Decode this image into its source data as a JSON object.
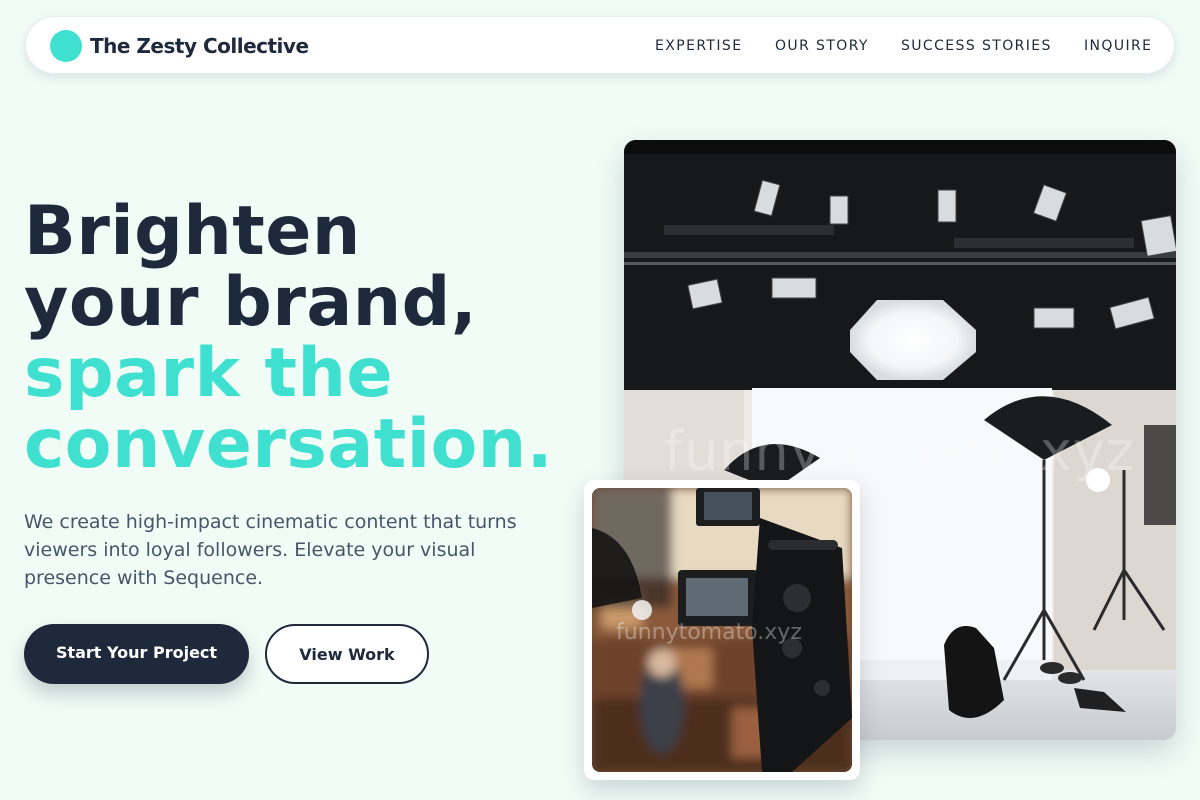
{
  "brand": {
    "name": "The Zesty Collective",
    "accent_color": "#40e0d0",
    "dark_color": "#1e293b"
  },
  "nav": {
    "links": [
      "EXPERTISE",
      "OUR STORY",
      "SUCCESS STORIES",
      "INQUIRE"
    ]
  },
  "hero": {
    "headline_lines": [
      "Brighten",
      "your brand,",
      "spark the",
      "conversation."
    ],
    "lead": "We create high-impact cinematic content that turns viewers into loyal followers. Elevate your visual presence with Sequence.",
    "primary_cta": "Start Your Project",
    "secondary_cta": "View Work"
  },
  "media": {
    "main_image": "studio-lighting-photo",
    "main_watermark": "funnytomato.xyz",
    "secondary_image": "camera-rig-photo",
    "secondary_watermark": "funnytomato.xyz"
  }
}
